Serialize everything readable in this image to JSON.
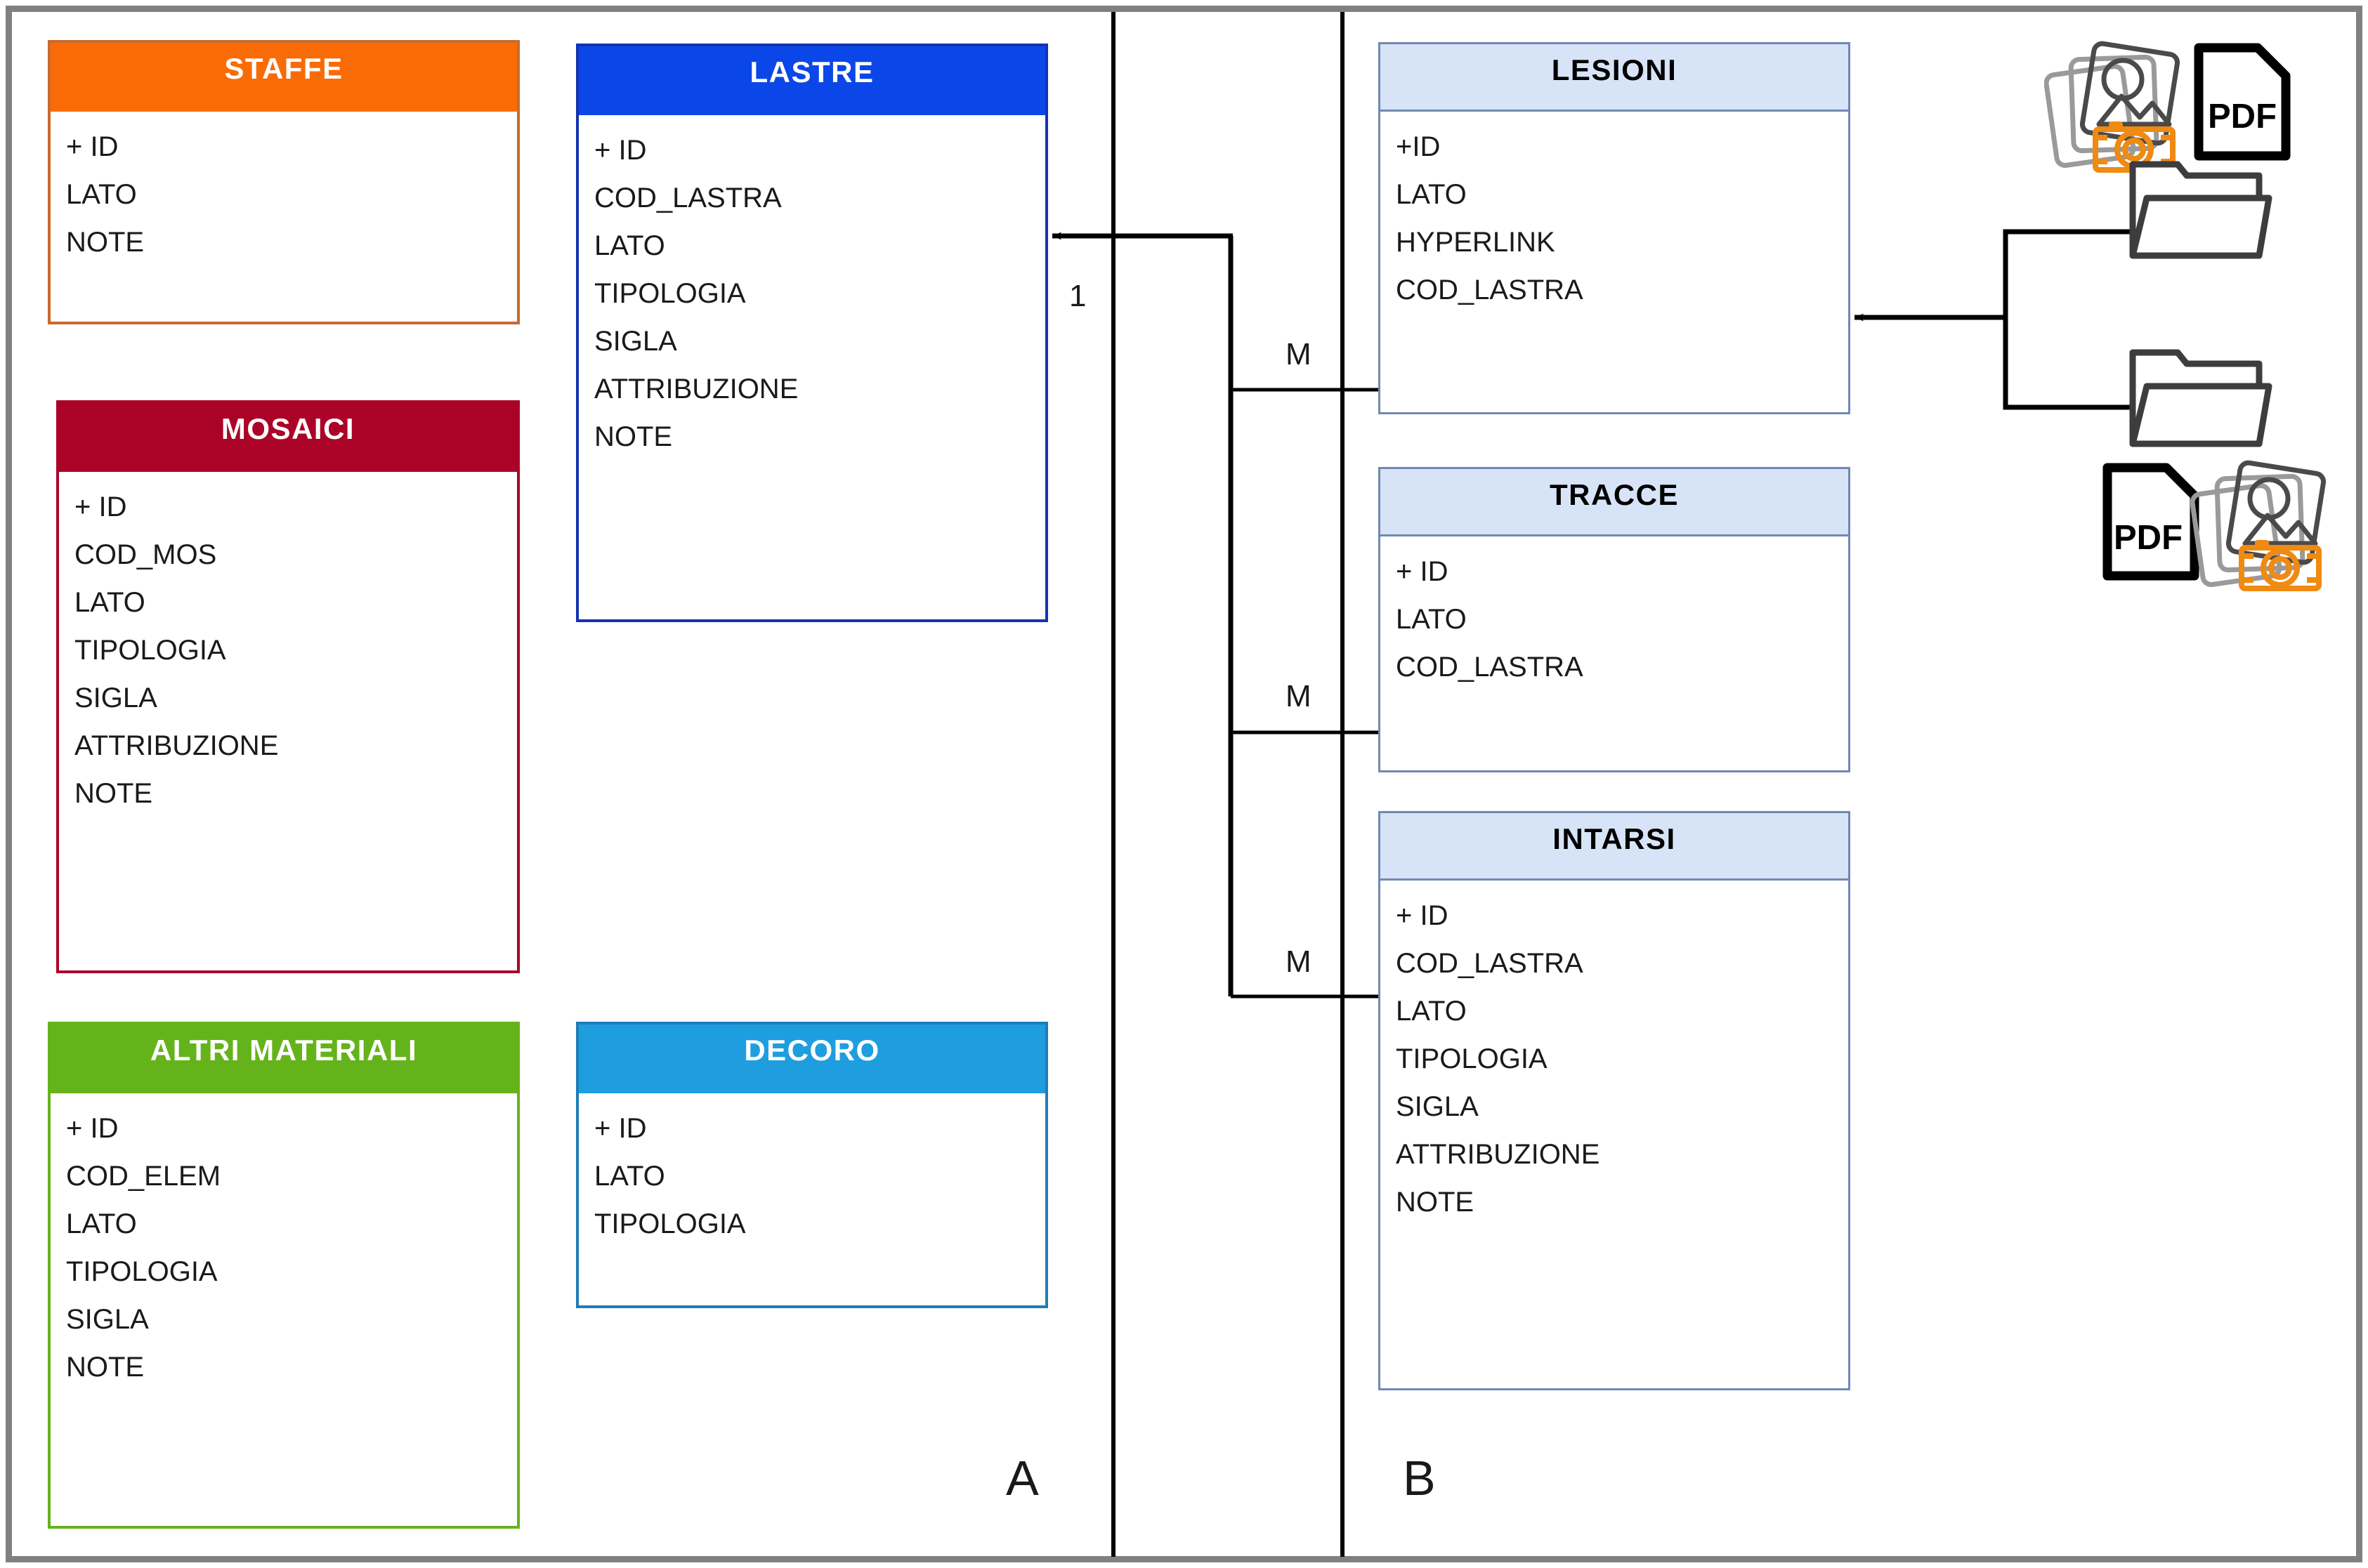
{
  "diagram": {
    "type": "entity-relationship-diagram",
    "panels": [
      {
        "id": "A",
        "label": "A"
      },
      {
        "id": "B",
        "label": "B"
      }
    ],
    "colors": {
      "staffe": "#f96b07",
      "lastre": "#0b47e8",
      "mosaici": "#ab0327",
      "altri_materiali": "#65b31b",
      "decoro": "#1f9edf",
      "lesioni": "#d7e4f7",
      "tracce": "#d7e4f7",
      "intarsi": "#d7e4f7",
      "light_blue_border": "#7089b3",
      "frame": "#808080",
      "camera_icon": "#ef8a12",
      "wire": "#000000"
    },
    "entities": [
      {
        "key": "staffe",
        "title": "STAFFE",
        "fields": [
          "+ ID",
          "LATO",
          "NOTE"
        ]
      },
      {
        "key": "mosaici",
        "title": "MOSAICI",
        "fields": [
          "+ ID",
          "COD_MOS",
          "LATO",
          "TIPOLOGIA",
          "SIGLA",
          "ATTRIBUZIONE",
          "NOTE"
        ]
      },
      {
        "key": "altri_materiali",
        "title": "ALTRI MATERIALI",
        "fields": [
          "+ ID",
          "COD_ELEM",
          "LATO",
          "TIPOLOGIA",
          "SIGLA",
          "NOTE"
        ]
      },
      {
        "key": "lastre",
        "title": "LASTRE",
        "fields": [
          "+ ID",
          "COD_LASTRA",
          "LATO",
          "TIPOLOGIA",
          "SIGLA",
          "ATTRIBUZIONE",
          "NOTE"
        ]
      },
      {
        "key": "decoro",
        "title": "DECORO",
        "fields": [
          "+ ID",
          "LATO",
          "TIPOLOGIA"
        ]
      },
      {
        "key": "lesioni",
        "title": "LESIONI",
        "fields": [
          "+ID",
          "LATO",
          "HYPERLINK",
          "COD_LASTRA"
        ]
      },
      {
        "key": "tracce",
        "title": "TRACCE",
        "fields": [
          "+ ID",
          "LATO",
          "COD_LASTRA"
        ]
      },
      {
        "key": "intarsi",
        "title": "INTARSI",
        "fields": [
          "+ ID",
          "COD_LASTRA",
          "LATO",
          "TIPOLOGIA",
          "SIGLA",
          "ATTRIBUZIONE",
          "NOTE"
        ]
      }
    ],
    "relationships": [
      {
        "from": "LESIONI.COD_LASTRA",
        "to": "LASTRE.COD_LASTRA",
        "from_cardinality": "M",
        "to_cardinality": "1"
      },
      {
        "from": "TRACCE.COD_LASTRA",
        "to": "LASTRE.COD_LASTRA",
        "from_cardinality": "M",
        "to_cardinality": "1"
      },
      {
        "from": "INTARSI.COD_LASTRA",
        "to": "LASTRE.COD_LASTRA",
        "from_cardinality": "M",
        "to_cardinality": "1"
      }
    ],
    "cardinalities": {
      "one": "1",
      "many_lesioni": "M",
      "many_tracce": "M",
      "many_intarsi": "M"
    },
    "attachments": [
      {
        "key": "top_cluster",
        "icons": [
          "photo-stack-icon",
          "camera-icon",
          "pdf-document-icon",
          "folder-icon"
        ],
        "pdf_label": "PDF"
      },
      {
        "key": "bottom_cluster",
        "icons": [
          "folder-icon",
          "pdf-document-icon",
          "photo-stack-icon",
          "camera-icon"
        ],
        "pdf_label": "PDF"
      }
    ],
    "attachment_link": {
      "target": "LESIONI.HYPERLINK",
      "description": "folders of photos and PDFs linked to HYPERLINK field"
    }
  }
}
